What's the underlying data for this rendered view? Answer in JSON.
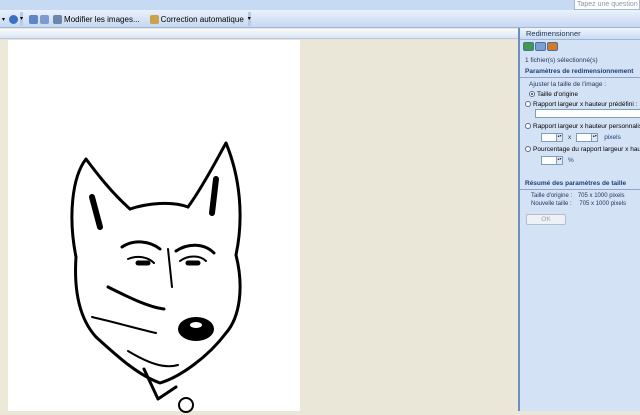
{
  "titlebar": {
    "help_placeholder": "Tapez une question"
  },
  "toolbar": {
    "modify_images": "Modifier les images...",
    "auto_correct": "Correction automatique"
  },
  "task_pane": {
    "title": "Redimensionner",
    "files_selected": "1 fichier(s) sélectionné(s)",
    "resize_params_heading": "Paramètres de redimensionnement",
    "adjust_label": "Ajuster la taille de l'image :",
    "options": {
      "original": "Taille d'origine",
      "predefined": "Rapport largeur x hauteur prédéfini :",
      "custom": "Rapport largeur x hauteur personnalisé :",
      "percent": "Pourcentage du rapport largeur x hauteur"
    },
    "unit_x": "x",
    "unit_pixels": "pixels",
    "unit_percent": "%",
    "summary_heading": "Résumé des paramètres de taille",
    "original_size_label": "Taille d'origine :",
    "original_size_value": "705 x 1000 pixels",
    "new_size_label": "Nouvelle taille :",
    "new_size_value": "705 x 1000 pixels",
    "ok_label": "OK"
  }
}
